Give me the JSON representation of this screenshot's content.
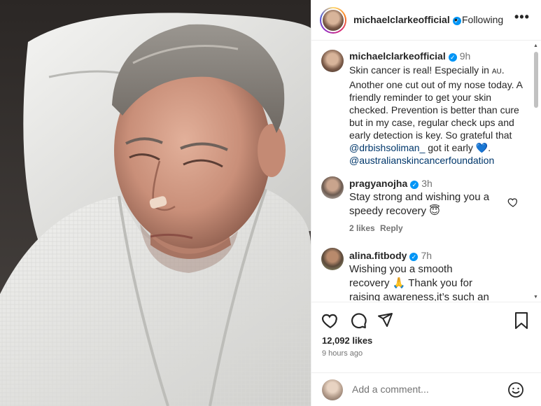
{
  "post": {
    "username": "michaelclarkeofficial",
    "follow_separator": "•",
    "follow_status": "Following",
    "more_label": "•••"
  },
  "caption": {
    "username": "michaelclarkeofficial",
    "time": "9h",
    "text_1": "Skin cancer is real! Especially in ",
    "flag": "AU",
    "text_2": ". Another one cut out of my nose today. A friendly reminder to get your skin checked. Prevention is better than cure but in my case, regular check ups and early detection is key. So grateful that ",
    "mention_1": "@drbishsoliman_",
    "text_3": " got it early ",
    "emoji": "💙",
    "text_4": ". ",
    "mention_2": "@australianskincancerfoundation"
  },
  "comments": [
    {
      "username": "pragyanojha",
      "time": "3h",
      "text": "Stay strong and wishing you a speedy recovery 😇",
      "likes": "2 likes",
      "reply": "Reply"
    },
    {
      "username": "alina.fitbody",
      "time": "7h",
      "text": "Wishing you a smooth recovery 🙏 Thank you for raising awareness,it’s such an"
    }
  ],
  "stats": {
    "likes": "12,092 likes",
    "posted": "9 hours ago"
  },
  "add_comment": {
    "placeholder": "Add a comment..."
  },
  "icons": {
    "like": "heart-icon",
    "comment": "comment-icon",
    "share": "send-icon",
    "save": "bookmark-icon",
    "emoji": "emoji-icon",
    "verified": "verified-badge-icon"
  },
  "colors": {
    "verified": "#0095f6",
    "mention": "#00376b",
    "muted": "#737373",
    "text": "#262626"
  }
}
